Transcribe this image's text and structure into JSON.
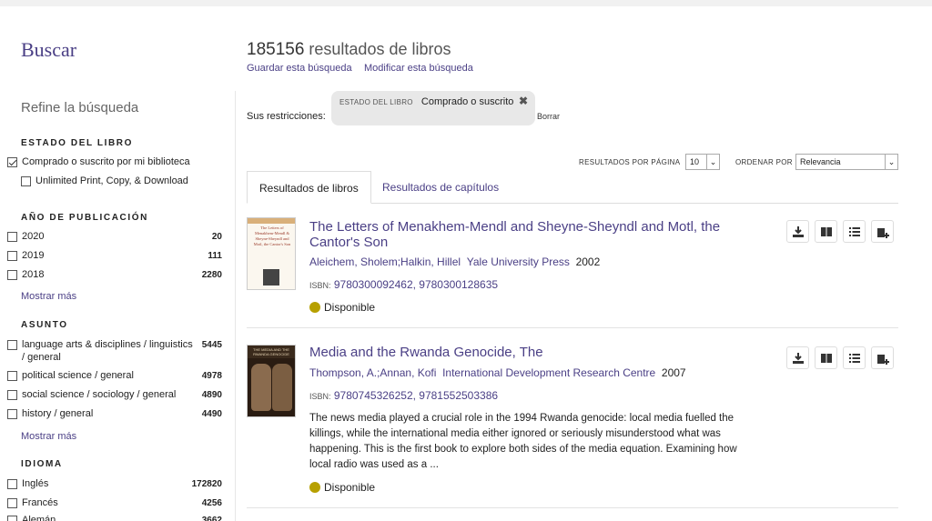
{
  "sidebar": {
    "title": "Buscar",
    "refine": "Refine la búsqueda",
    "facets": [
      {
        "heading": "ESTADO DEL LIBRO",
        "items": [
          {
            "label": "Comprado o suscrito por mi biblioteca",
            "count": "",
            "checked": true
          },
          {
            "label": "Unlimited Print, Copy, & Download",
            "count": "",
            "checked": false
          }
        ]
      },
      {
        "heading": "AÑO DE PUBLICACIÓN",
        "items": [
          {
            "label": "2020",
            "count": "20",
            "checked": false
          },
          {
            "label": "2019",
            "count": "111",
            "checked": false
          },
          {
            "label": "2018",
            "count": "2280",
            "checked": false
          }
        ],
        "more": "Mostrar más"
      },
      {
        "heading": "ASUNTO",
        "items": [
          {
            "label": "language arts & disciplines / linguistics / general",
            "count": "5445",
            "checked": false
          },
          {
            "label": "political science / general",
            "count": "4978",
            "checked": false
          },
          {
            "label": "social science / sociology / general",
            "count": "4890",
            "checked": false
          },
          {
            "label": "history / general",
            "count": "4490",
            "checked": false
          }
        ],
        "more": "Mostrar más"
      },
      {
        "heading": "IDIOMA",
        "items": [
          {
            "label": "Inglés",
            "count": "172820",
            "checked": false
          },
          {
            "label": "Francés",
            "count": "4256",
            "checked": false
          },
          {
            "label": "Alemán",
            "count": "3662",
            "checked": false
          }
        ]
      }
    ]
  },
  "main": {
    "count_number": "185156",
    "count_text": " resultados de libros",
    "save_search": "Guardar esta búsqueda",
    "modify_search": "Modificar esta búsqueda",
    "restrictions_label": "Sus restricciones:",
    "chip_key": "ESTADO DEL LIBRO",
    "chip_value": "Comprado o suscrito",
    "chip_close": "✖",
    "clear": "Borrar",
    "per_page_label": "RESULTADOS POR PÁGINA",
    "per_page_value": "10",
    "sort_label": "ORDENAR POR",
    "sort_value": "Relevancia",
    "tabs": [
      {
        "label": "Resultados de libros"
      },
      {
        "label": "Resultados de capítulos"
      }
    ],
    "results": [
      {
        "title": "The Letters of Menakhem-Mendl and Sheyne-Sheyndl and Motl, the Cantor's Son",
        "authors": "Aleichem, Sholem;Halkin, Hillel",
        "publisher": "Yale University Press",
        "year": "2002",
        "isbn_tag": "ISBN:",
        "isbns": "9780300092462, 9780300128635",
        "description": "",
        "availability": "Disponible",
        "cover_text": "The Letters of Menakhem-Mendl & Sheyne-Sheyndl and Motl, the Cantor's Son"
      },
      {
        "title": "Media and the Rwanda Genocide, The",
        "authors": "Thompson, A.;Annan, Kofi",
        "publisher": "International Development Research Centre",
        "year": "2007",
        "isbn_tag": "ISBN:",
        "isbns": "9780745326252, 9781552503386",
        "description": "The news media played a crucial role in the 1994 Rwanda genocide: local media fuelled the killings, while the international media either ignored or seriously misunderstood what was happening. This is the first book to explore both sides of the media equation. Examining how local radio was used as a ...",
        "availability": "Disponible",
        "cover_text": "THE MEDIA AND THE RWANDA GENOCIDE"
      }
    ]
  },
  "colors": {
    "accent": "#4a3f85",
    "available": "#b7a000"
  }
}
